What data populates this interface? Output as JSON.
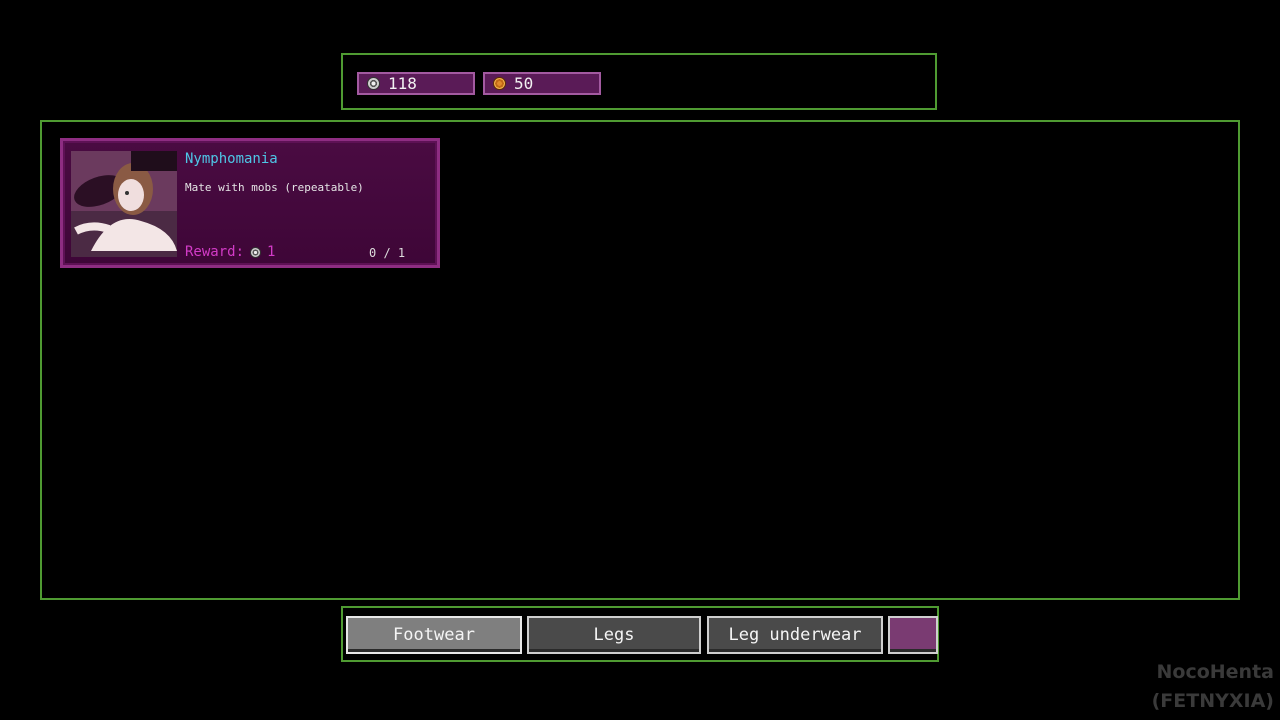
{
  "currencies": [
    {
      "icon": "silver-coin-icon",
      "value": "118"
    },
    {
      "icon": "gold-coin-icon",
      "value": "50"
    }
  ],
  "quest": {
    "title": "Nymphomania",
    "description": "Mate with mobs (repeatable)",
    "reward_label": "Reward:",
    "reward_amount": "1",
    "progress": "0 / 1"
  },
  "tabs": [
    {
      "label": "Footwear",
      "active": true
    },
    {
      "label": "Legs",
      "active": false
    },
    {
      "label": "Leg underwear",
      "active": false
    },
    {
      "label": "",
      "active": false
    }
  ],
  "watermark": {
    "line1": "NocoHenta",
    "line2": "(FETNYXIA)"
  },
  "colors": {
    "frame_green": "#4f9b32",
    "card_purple": "#4a0b42",
    "title_cyan": "#4ec6e6",
    "reward_pink": "#d23bc7"
  }
}
